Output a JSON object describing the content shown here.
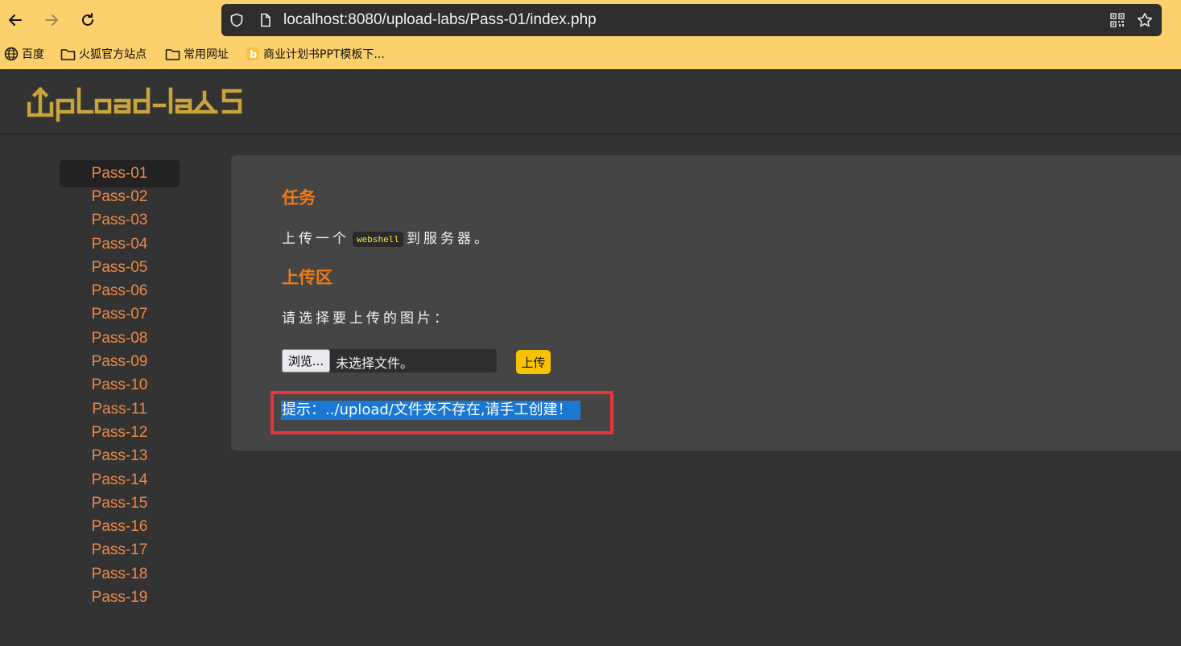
{
  "browser": {
    "url": "localhost:8080/upload-labs/Pass-01/index.php",
    "bookmarks": [
      "百度",
      "火狐官方站点",
      "常用网址",
      "商业计划书PPT模板下..."
    ]
  },
  "site": {
    "logo_text": "UpLoad-labs"
  },
  "sidebar": {
    "items": [
      "Pass-01",
      "Pass-02",
      "Pass-03",
      "Pass-04",
      "Pass-05",
      "Pass-06",
      "Pass-07",
      "Pass-08",
      "Pass-09",
      "Pass-10",
      "Pass-11",
      "Pass-12",
      "Pass-13",
      "Pass-14",
      "Pass-15",
      "Pass-16",
      "Pass-17",
      "Pass-18",
      "Pass-19"
    ],
    "active": "Pass-01"
  },
  "main": {
    "task_heading": "任务",
    "task_text_before": "上传一个",
    "task_code": "webshell",
    "task_text_after": "到服务器。",
    "upload_heading": "上传区",
    "choose_label": "请选择要上传的图片：",
    "browse_label": "浏览...",
    "file_status": "未选择文件。",
    "upload_button": "上传",
    "hint": "提示：../upload/文件夹不存在,请手工创建！"
  },
  "colors": {
    "chrome": "#fcd06d",
    "accent": "#f07a14",
    "link": "#ec8848",
    "logo": "#c9a43a",
    "highlight": "#1a77d2",
    "annotation": "#e8343a"
  }
}
